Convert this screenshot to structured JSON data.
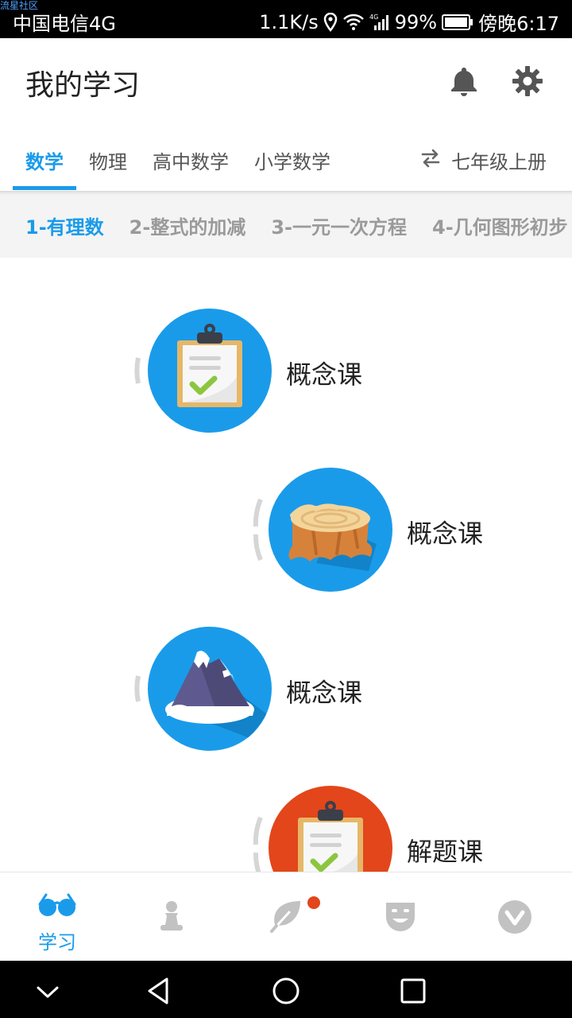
{
  "status_bar": {
    "watermark": "流星社区",
    "carrier": "中国电信4G",
    "speed": "1.1K/s",
    "battery": "99%",
    "time": "傍晚6:17"
  },
  "header": {
    "title": "我的学习"
  },
  "subject_tabs": [
    {
      "label": "数学",
      "active": true
    },
    {
      "label": "物理",
      "active": false
    },
    {
      "label": "高中数学",
      "active": false
    },
    {
      "label": "小学数学",
      "active": false
    }
  ],
  "grade": "七年级上册",
  "chapters": [
    {
      "label": "1-有理数",
      "active": true
    },
    {
      "label": "2-整式的加减",
      "active": false
    },
    {
      "label": "3-一元一次方程",
      "active": false
    },
    {
      "label": "4-几何图形初步",
      "active": false
    }
  ],
  "lessons": [
    {
      "label": "概念课",
      "icon": "clipboard-check-icon"
    },
    {
      "label": "概念课",
      "icon": "tree-stump-icon"
    },
    {
      "label": "概念课",
      "icon": "snowy-mountain-icon"
    },
    {
      "label": "解题课",
      "icon": "clipboard-check-icon"
    }
  ],
  "bottom_nav": {
    "study_label": "学习"
  },
  "colors": {
    "accent": "#1a9bea",
    "orange": "#e3461a",
    "inactive": "#b8b8b8"
  }
}
